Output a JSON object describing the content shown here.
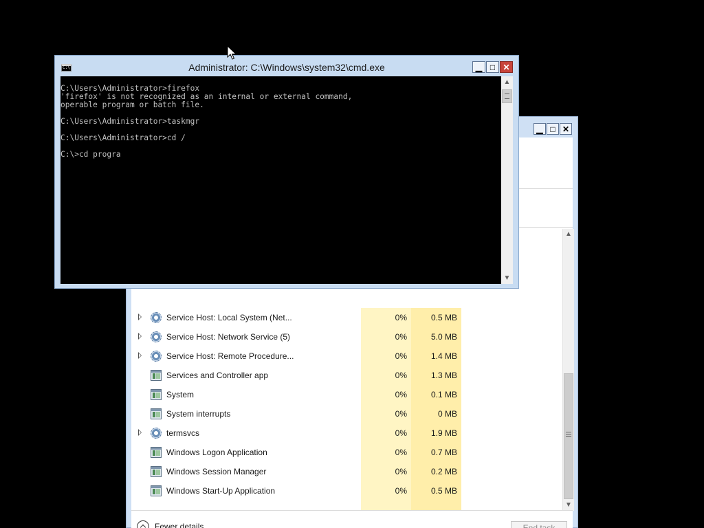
{
  "cmd": {
    "title": "Administrator: C:\\Windows\\system32\\cmd.exe",
    "lines": [
      "C:\\Users\\Administrator>firefox",
      "'firefox' is not recognized as an internal or external command,",
      "operable program or batch file.",
      "",
      "C:\\Users\\Administrator>taskmgr",
      "",
      "C:\\Users\\Administrator>cd /",
      "",
      "C:\\>cd progra"
    ]
  },
  "taskmgr": {
    "processes": [
      {
        "name": "Service Host: Local System (Net...",
        "cpu": "0%",
        "memory": "0.5 MB",
        "icon": "gear-icon",
        "expandable": true
      },
      {
        "name": "Service Host: Network Service (5)",
        "cpu": "0%",
        "memory": "5.0 MB",
        "icon": "gear-icon",
        "expandable": true
      },
      {
        "name": "Service Host: Remote Procedure...",
        "cpu": "0%",
        "memory": "1.4 MB",
        "icon": "gear-icon",
        "expandable": true
      },
      {
        "name": "Services and Controller app",
        "cpu": "0%",
        "memory": "1.3 MB",
        "icon": "window-icon",
        "expandable": false
      },
      {
        "name": "System",
        "cpu": "0%",
        "memory": "0.1 MB",
        "icon": "window-icon",
        "expandable": false
      },
      {
        "name": "System interrupts",
        "cpu": "0%",
        "memory": "0 MB",
        "icon": "window-icon",
        "expandable": false
      },
      {
        "name": "termsvcs",
        "cpu": "0%",
        "memory": "1.9 MB",
        "icon": "gear-icon",
        "expandable": true
      },
      {
        "name": "Windows Logon Application",
        "cpu": "0%",
        "memory": "0.7 MB",
        "icon": "window-icon",
        "expandable": false
      },
      {
        "name": "Windows Session Manager",
        "cpu": "0%",
        "memory": "0.2 MB",
        "icon": "window-icon",
        "expandable": false
      },
      {
        "name": "Windows Start-Up Application",
        "cpu": "0%",
        "memory": "0.5 MB",
        "icon": "window-icon",
        "expandable": false
      }
    ],
    "footer": {
      "fewer_details_label": "Fewer details",
      "end_task_label": "End task"
    }
  },
  "colors": {
    "cpu_column": "#fff5c4",
    "memory_column": "#ffeeaa",
    "close_button": "#c8443b",
    "window_frame": "#c8dcf2"
  }
}
